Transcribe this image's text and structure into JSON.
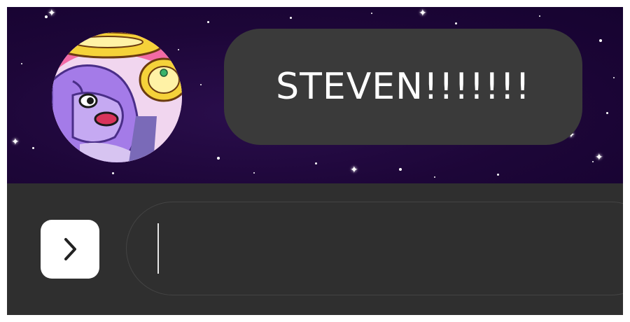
{
  "chat": {
    "avatar_icon": "character-avatar-icon",
    "message_text": "STEVEN!!!!!!!"
  },
  "composer": {
    "expand_icon": "chevron-right-icon",
    "input_value": "",
    "input_placeholder": ""
  },
  "colors": {
    "background_space": "#1d0638",
    "bubble": "#3a3a3a",
    "bar": "#2f2f2f",
    "text": "#ffffff"
  }
}
